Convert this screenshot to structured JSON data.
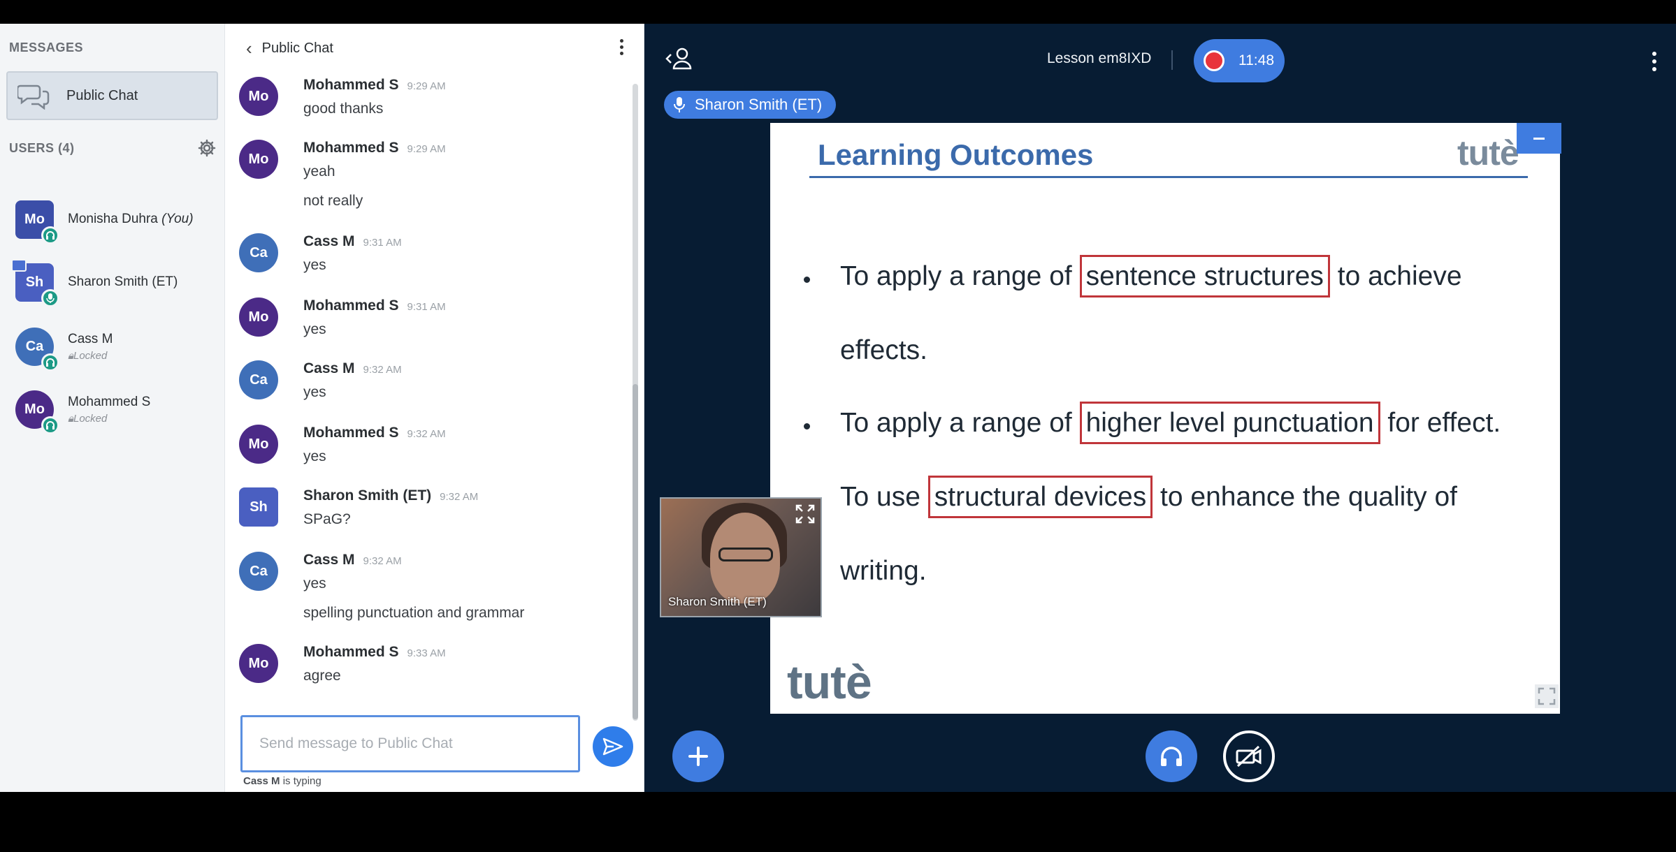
{
  "sidebar": {
    "messages_title": "MESSAGES",
    "public_chat_label": "Public Chat",
    "users_title": "USERS (4)",
    "users": [
      {
        "initials": "Mo",
        "name": "Monisha Duhra",
        "suffix": "(You)",
        "sub": "",
        "color": "#3b4ea8"
      },
      {
        "initials": "Sh",
        "name": "Sharon Smith (ET)",
        "suffix": "",
        "sub": "",
        "color": "#4a5fc1"
      },
      {
        "initials": "Ca",
        "name": "Cass M",
        "suffix": "",
        "sub": "Locked",
        "color": "#3f6fb8"
      },
      {
        "initials": "Mo",
        "name": "Mohammed S",
        "suffix": "",
        "sub": "Locked",
        "color": "#4b2a87"
      }
    ]
  },
  "chat": {
    "title": "Public Chat",
    "messages": [
      {
        "initials": "Mo",
        "name": "Mohammed S",
        "time": "9:29 AM",
        "lines": [
          "good thanks"
        ],
        "color": "#4b2a87"
      },
      {
        "initials": "Mo",
        "name": "Mohammed S",
        "time": "9:29 AM",
        "lines": [
          "yeah",
          "not really"
        ],
        "color": "#4b2a87"
      },
      {
        "initials": "Ca",
        "name": "Cass M",
        "time": "9:31 AM",
        "lines": [
          "yes"
        ],
        "color": "#3f6fb8"
      },
      {
        "initials": "Mo",
        "name": "Mohammed S",
        "time": "9:31 AM",
        "lines": [
          "yes"
        ],
        "color": "#4b2a87"
      },
      {
        "initials": "Ca",
        "name": "Cass M",
        "time": "9:32 AM",
        "lines": [
          "yes"
        ],
        "color": "#3f6fb8"
      },
      {
        "initials": "Mo",
        "name": "Mohammed S",
        "time": "9:32 AM",
        "lines": [
          "yes"
        ],
        "color": "#4b2a87"
      },
      {
        "initials": "Sh",
        "name": "Sharon Smith (ET)",
        "time": "9:32 AM",
        "lines": [
          "SPaG?"
        ],
        "color": "#4a5fc1"
      },
      {
        "initials": "Ca",
        "name": "Cass M",
        "time": "9:32 AM",
        "lines": [
          "yes",
          "spelling punctuation and grammar"
        ],
        "color": "#3f6fb8"
      },
      {
        "initials": "Mo",
        "name": "Mohammed S",
        "time": "9:33 AM",
        "lines": [
          "agree"
        ],
        "color": "#4b2a87"
      }
    ],
    "input_placeholder": "Send message to Public Chat",
    "typing_user": "Cass M",
    "typing_suffix": " is typing"
  },
  "stage": {
    "lesson_title": "Lesson em8IXD",
    "recording_time": "11:48",
    "talker": "Sharon Smith (ET)",
    "webcam_label": "Sharon Smith (ET)",
    "slide": {
      "title": "Learning Outcomes",
      "brand": "tutè",
      "b1_pre": "To apply a range of ",
      "b1_hl": "sentence structures",
      "b1_post": " to achieve",
      "b1_cont": "effects.",
      "b2_pre": "To apply a range of ",
      "b2_hl": "higher level punctuation",
      "b2_post": " for effect.",
      "b3_pre": "To use ",
      "b3_hl": "structural devices",
      "b3_post": " to enhance the quality of",
      "b3_cont": "writing."
    }
  },
  "colors": {
    "accent": "#3f7ce0",
    "stage_bg": "#071c33",
    "highlight_box": "#c0353a",
    "status_green": "#1c9a86"
  }
}
